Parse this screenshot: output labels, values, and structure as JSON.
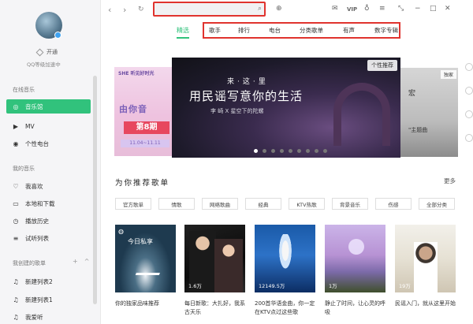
{
  "sidebar": {
    "vip_label": "开通",
    "level_text": "QQ等级加速中",
    "sections": {
      "online": "在线音乐",
      "mine": "我的音乐",
      "created": "我创建的歌单"
    },
    "online_items": [
      {
        "label": "音乐馆",
        "icon": "music-hall-icon",
        "glyph": "◎"
      },
      {
        "label": "MV",
        "icon": "mv-icon",
        "glyph": "▶"
      },
      {
        "label": "个性电台",
        "icon": "radio-icon",
        "glyph": "◉"
      }
    ],
    "my_items": [
      {
        "label": "我喜欢",
        "icon": "heart-icon",
        "glyph": "♡"
      },
      {
        "label": "本地和下载",
        "icon": "download-icon",
        "glyph": "▭"
      },
      {
        "label": "播放历史",
        "icon": "history-icon",
        "glyph": "◷"
      },
      {
        "label": "试听列表",
        "icon": "playlist-icon",
        "glyph": "≡"
      }
    ],
    "created_items": [
      {
        "label": "新建列表2",
        "icon": "music-note-icon",
        "glyph": "♫"
      },
      {
        "label": "新建列表1",
        "icon": "music-note-icon",
        "glyph": "♫"
      },
      {
        "label": "我爱听",
        "icon": "music-note-icon",
        "glyph": "♫"
      }
    ]
  },
  "topbar": {
    "search_placeholder": "",
    "vip": "VIP"
  },
  "tabs": {
    "selected": "精选",
    "items": [
      "歌手",
      "排行",
      "电台",
      "分类歌单",
      "有声",
      "数字专辑"
    ]
  },
  "banner": {
    "left": {
      "logo": "SHE 听见好时光",
      "title": "由你音",
      "episode": "第8期",
      "date": "11.04~11.11"
    },
    "center": {
      "line1": "来·这·里",
      "line2": "用民谣写意你的生活",
      "line3": "李 崎 X 星空下的陀螺",
      "tag": "个性推荐"
    },
    "right": {
      "tag": "独家",
      "t1": "宏",
      "t2": "\"主题曲"
    },
    "dots": 9
  },
  "playlists": {
    "title": "为你推荐歌单",
    "more": "更多",
    "chips": [
      "官方歌单",
      "情歌",
      "网络歌曲",
      "经典",
      "KTV热歌",
      "背景音乐",
      "伤感",
      "全部分类"
    ],
    "cards": [
      {
        "label": "今日私享",
        "count": "",
        "title": "你的独家品味推荐"
      },
      {
        "count": "1.6万",
        "title": "每日新歌：大扎好，我系古天乐"
      },
      {
        "count": "12149.5万",
        "title": "200首华语金曲，你一定在KTV点过这些歌"
      },
      {
        "count": "1万",
        "title": "静止了时间，让心灵的呼吸"
      },
      {
        "count": "19万",
        "title": "民谣入门，就从这里开始"
      }
    ]
  },
  "colors": {
    "accent": "#31c27c",
    "highlight_box": "#e0332e"
  }
}
